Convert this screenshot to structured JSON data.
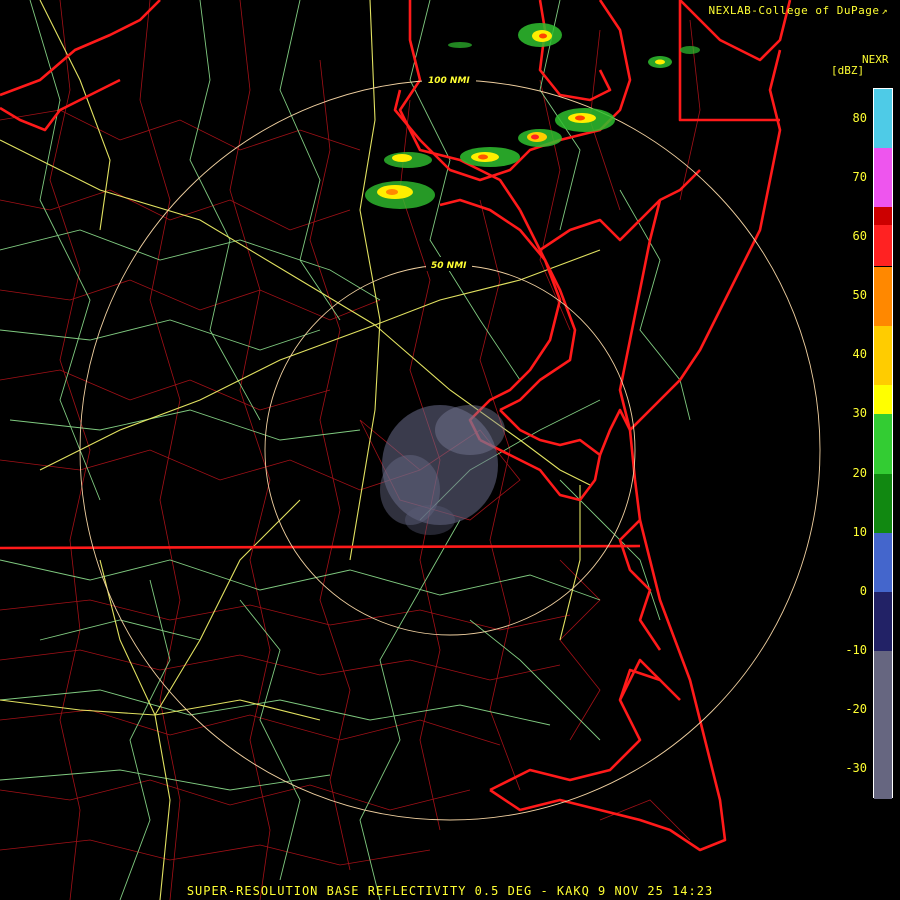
{
  "header": {
    "credit": "NEXLAB-College of DuPage",
    "credit_icon": "external-link-icon",
    "product": "NEXR",
    "units": "[dBZ]"
  },
  "rings": [
    {
      "label": "100 NMI"
    },
    {
      "label": "50 NMI"
    }
  ],
  "colorbar": {
    "max": 85,
    "min": -35,
    "ticks": [
      "80",
      "70",
      "60",
      "50",
      "40",
      "30",
      "20",
      "10",
      "0",
      "-10",
      "-20",
      "-30"
    ],
    "tick_values": [
      80,
      70,
      60,
      50,
      40,
      30,
      20,
      10,
      0,
      -10,
      -20,
      -30
    ],
    "bands": [
      {
        "from": 75,
        "to": 85,
        "color": "#4ecbe7"
      },
      {
        "from": 65,
        "to": 75,
        "color": "#ee55ee"
      },
      {
        "from": 62,
        "to": 65,
        "color": "#cc0000"
      },
      {
        "from": 55,
        "to": 62,
        "color": "#ff2222"
      },
      {
        "from": 45,
        "to": 55,
        "color": "#ff8800"
      },
      {
        "from": 35,
        "to": 45,
        "color": "#ffcc00"
      },
      {
        "from": 30,
        "to": 35,
        "color": "#ffff00"
      },
      {
        "from": 20,
        "to": 30,
        "color": "#33cc33"
      },
      {
        "from": 10,
        "to": 20,
        "color": "#118811"
      },
      {
        "from": 0,
        "to": 10,
        "color": "#4466cc"
      },
      {
        "from": -10,
        "to": 0,
        "color": "#222266"
      },
      {
        "from": -35,
        "to": -10,
        "color": "#666680"
      }
    ]
  },
  "footer": "SUPER-RESOLUTION BASE REFLECTIVITY 0.5 DEG - KAKQ 9 NOV 25 14:23",
  "colors": {
    "state_border": "#ff1a1a",
    "county_border": "#cc1111",
    "highway_major": "#eeee77",
    "highway_minor": "#99ee99",
    "range_ring": "#f0d0a0",
    "label": "#ffff33"
  }
}
